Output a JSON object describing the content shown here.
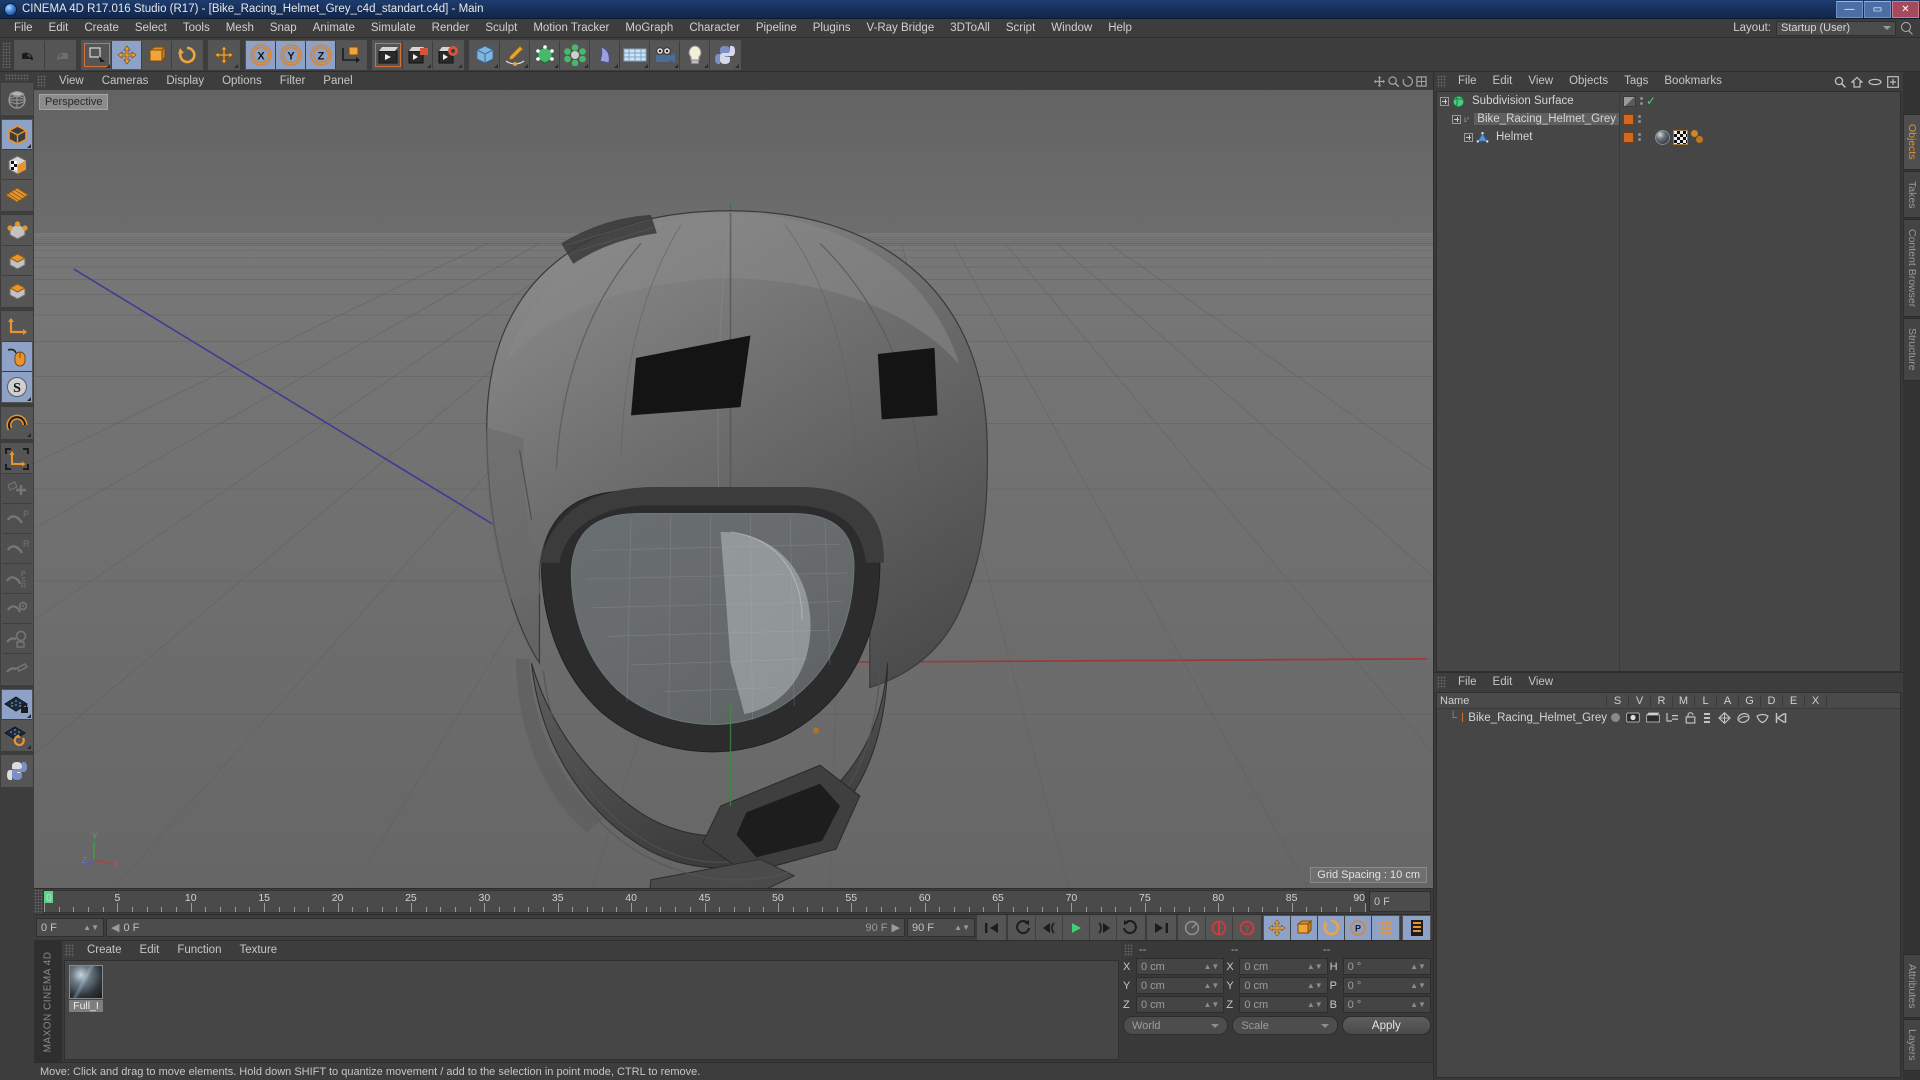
{
  "window": {
    "title": "CINEMA 4D R17.016 Studio (R17) - [Bike_Racing_Helmet_Grey_c4d_standart.c4d] - Main",
    "minimize": "—",
    "maximize": "▭",
    "close": "✕"
  },
  "menubar": {
    "items": [
      "File",
      "Edit",
      "Create",
      "Select",
      "Tools",
      "Mesh",
      "Snap",
      "Animate",
      "Simulate",
      "Render",
      "Sculpt",
      "Motion Tracker",
      "MoGraph",
      "Character",
      "Pipeline",
      "Plugins",
      "V-Ray Bridge",
      "3DToAll",
      "Script",
      "Window",
      "Help"
    ],
    "layout_label": "Layout:",
    "layout_value": "Startup (User)"
  },
  "viewport": {
    "menu": [
      "View",
      "Cameras",
      "Display",
      "Options",
      "Filter",
      "Panel"
    ],
    "perspective_tag": "Perspective",
    "grid_spacing": "Grid Spacing : 10 cm",
    "axis_labels": {
      "x": "X",
      "y": "Y",
      "z": "Z"
    }
  },
  "timeline": {
    "ticks": [
      0,
      5,
      10,
      15,
      20,
      25,
      30,
      35,
      40,
      45,
      50,
      55,
      60,
      65,
      70,
      75,
      80,
      85,
      90
    ],
    "end_field": "0 F",
    "current_frame": "0 F",
    "frame_display": "0 F",
    "range_end": "90 F",
    "range_value": "90 F"
  },
  "material_manager": {
    "menu": [
      "Create",
      "Edit",
      "Function",
      "Texture"
    ],
    "materials": [
      {
        "name": "Full_I"
      }
    ]
  },
  "coordinates": {
    "headers": [
      "--",
      "--",
      "--"
    ],
    "rows": [
      {
        "pos_label": "X",
        "pos_value": "0 cm",
        "size_label": "X",
        "size_value": "0 cm",
        "rot_label": "H",
        "rot_value": "0 °"
      },
      {
        "pos_label": "Y",
        "pos_value": "0 cm",
        "size_label": "Y",
        "size_value": "0 cm",
        "rot_label": "P",
        "rot_value": "0 °"
      },
      {
        "pos_label": "Z",
        "pos_value": "0 cm",
        "size_label": "Z",
        "size_value": "0 cm",
        "rot_label": "B",
        "rot_value": "0 °"
      }
    ],
    "world_select": "World",
    "scale_select": "Scale",
    "apply_button": "Apply"
  },
  "status_bar": {
    "text": "Move: Click and drag to move elements. Hold down SHIFT to quantize movement / add to the selection in point mode, CTRL to remove."
  },
  "object_manager": {
    "menu": [
      "File",
      "Edit",
      "View",
      "Objects",
      "Tags",
      "Bookmarks"
    ],
    "objects": [
      {
        "name": "Subdivision Surface",
        "depth": 0,
        "type": "generator",
        "selected": false
      },
      {
        "name": "Bike_Racing_Helmet_Grey",
        "depth": 1,
        "type": "null",
        "selected": true
      },
      {
        "name": "Helmet",
        "depth": 2,
        "type": "polygon",
        "selected": false
      }
    ]
  },
  "layer_manager": {
    "menu": [
      "File",
      "Edit",
      "View"
    ],
    "columns": [
      "Name",
      "S",
      "V",
      "R",
      "M",
      "L",
      "A",
      "G",
      "D",
      "E",
      "X"
    ],
    "rows": [
      {
        "name": "Bike_Racing_Helmet_Grey"
      }
    ]
  },
  "side_tabs": {
    "top": [
      "Objects",
      "Takes",
      "Content Browser",
      "Structure"
    ],
    "bottom": [
      "Attributes",
      "Layers"
    ]
  },
  "brand": {
    "text": "MAXON CINEMA 4D"
  },
  "colors": {
    "accent_orange": "#e0932e",
    "selection_blue": "#8ea2c8",
    "title_blue": "#1d3c6e",
    "green_check": "#4ad07c"
  }
}
